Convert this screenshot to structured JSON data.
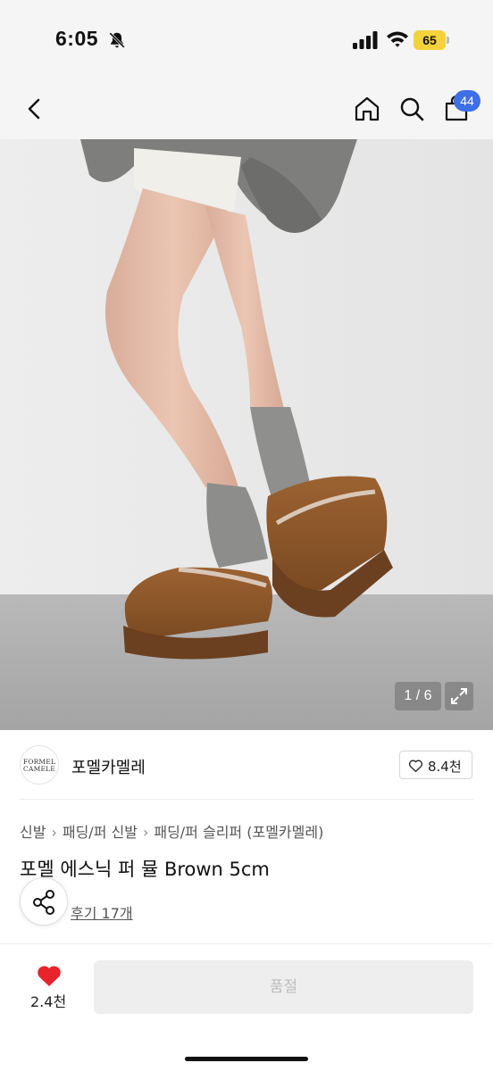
{
  "status_bar": {
    "time": "6:05",
    "battery": "65",
    "icons": [
      "bell-slash-icon",
      "cellular-signal-icon",
      "wifi-icon",
      "battery-icon"
    ],
    "battery_color": "#f3d23a"
  },
  "nav": {
    "icons": [
      "chevron-left-icon",
      "home-icon",
      "search-icon",
      "shopping-bag-icon"
    ],
    "cart_badge": "44",
    "badge_color": "#3f6fe6"
  },
  "gallery": {
    "counter": "1 / 6",
    "current_index": 1,
    "total": 6,
    "expand_icon": "expand-icon"
  },
  "brand": {
    "logo_lines": [
      "FORMEL",
      "CAMELE"
    ],
    "name": "포멜카멜레",
    "like_count": "8.4천"
  },
  "breadcrumb": [
    "신발",
    "패딩/퍼 신발",
    "패딩/퍼 슬리퍼 (포멜카멜레)"
  ],
  "product": {
    "title": "포멜 에스닉 퍼 뮬 Brown 5cm",
    "reviews": "후기 17개"
  },
  "bottom_bar": {
    "wishlist_count": "2.4천",
    "heart_color": "#e8232c",
    "buy_button_label": "품절"
  }
}
